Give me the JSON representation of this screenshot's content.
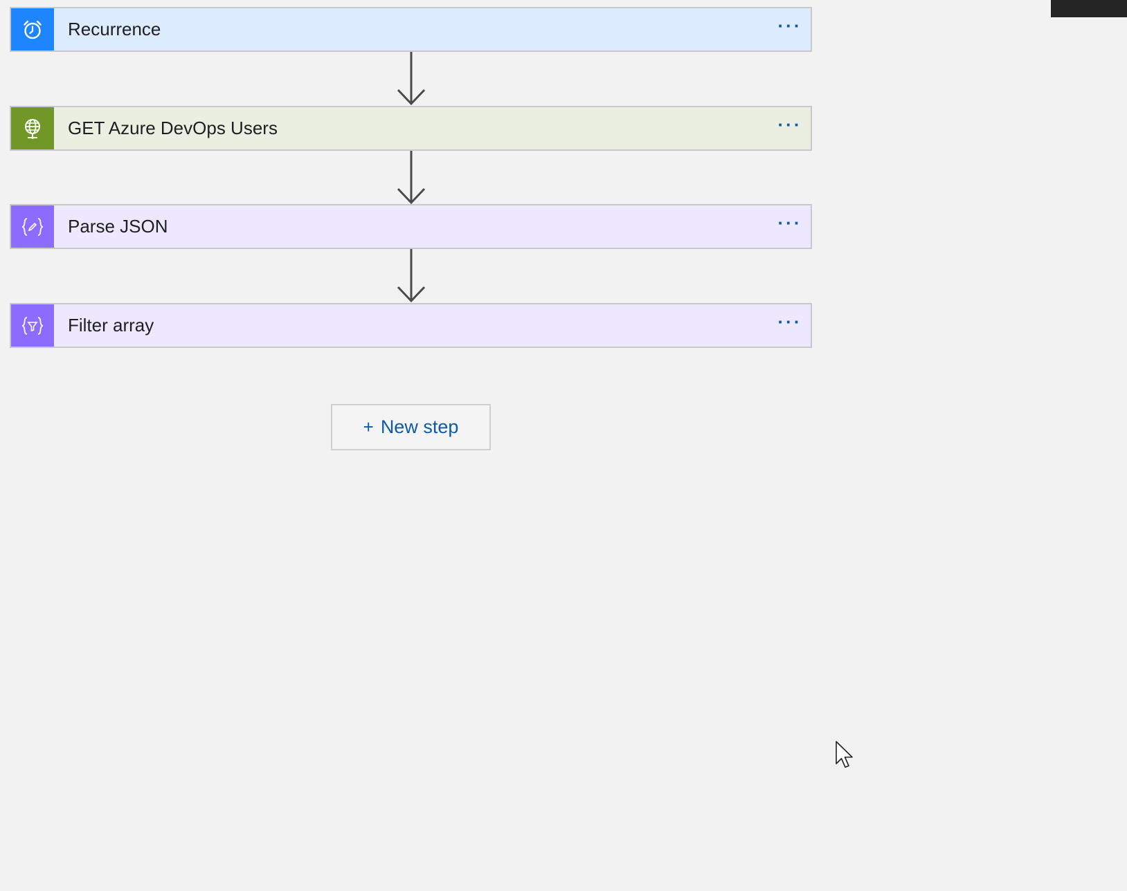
{
  "flow": {
    "steps": [
      {
        "label": "Recurrence",
        "icon": "alarm-clock-icon",
        "menu": "...",
        "icon_bg": "#1f85ff",
        "row_bg": "#dcebfe"
      },
      {
        "label": "GET Azure DevOps Users",
        "icon": "globe-icon",
        "menu": "...",
        "icon_bg": "#709727",
        "row_bg": "#ebefe1"
      },
      {
        "label": "Parse JSON",
        "icon": "braces-pencil-icon",
        "menu": "...",
        "icon_bg": "#8c6cff",
        "row_bg": "#ede8fe"
      },
      {
        "label": "Filter array",
        "icon": "braces-filter-icon",
        "menu": "...",
        "icon_bg": "#8c6cff",
        "row_bg": "#ede8fe"
      }
    ],
    "new_step": {
      "plus": "+",
      "label": "New step"
    }
  },
  "colors": {
    "canvas_bg": "#f2f2f2",
    "accent_link": "#0e5aa7",
    "connector": "#4a4a4a"
  }
}
